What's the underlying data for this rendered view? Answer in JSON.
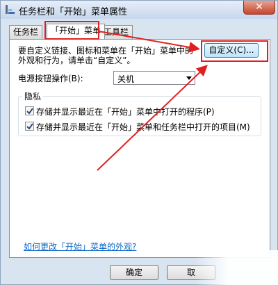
{
  "window": {
    "title": "任务栏和「开始」菜单属性",
    "close_symbol": "✕"
  },
  "tabs": [
    {
      "label": "任务栏",
      "active": false
    },
    {
      "label": "「开始」菜单",
      "active": true
    },
    {
      "label": "工具栏",
      "active": false
    }
  ],
  "panel": {
    "description_line1": "要自定义链接、图标和菜单在「开始」菜单中的",
    "description_line2": "外观和行为，请单击“自定义”。",
    "customize_label": "自定义(C)...",
    "power_button_label": "电源按钮操作(B):",
    "power_button_value": "关机",
    "privacy_title": "隐私",
    "privacy_option1": "存储并显示最近在「开始」菜单中打开的程序(P)",
    "privacy_option2": "存储并显示最近在「开始」菜单和任务栏中打开的项目(M)",
    "privacy_option1_checked": true,
    "privacy_option2_checked": true,
    "help_link": "如何更改「开始」菜单的外观?"
  },
  "footer": {
    "ok_label": "确定",
    "cancel_label": "取"
  },
  "colors": {
    "highlight": "#e02020",
    "link": "#0b67c8",
    "window_frame": "#d9e4f1"
  }
}
